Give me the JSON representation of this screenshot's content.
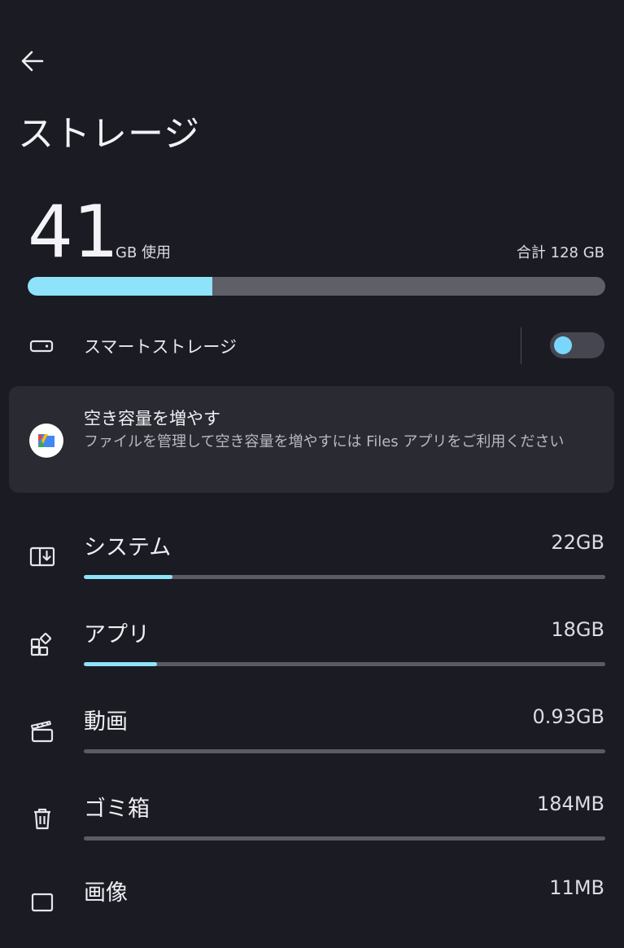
{
  "header": {
    "back_icon": "arrow-left-icon",
    "title": "ストレージ"
  },
  "summary": {
    "used_value": "41",
    "used_unit": "GB 使用",
    "total": "合計 128 GB",
    "used_fraction": 0.32
  },
  "smart_storage": {
    "icon": "storage-toggle-icon",
    "label": "スマートストレージ",
    "enabled": false
  },
  "files_card": {
    "icon": "files-app-icon",
    "title": "空き容量を増やす",
    "description": "ファイルを管理して空き容量を増やすには Files アプリをご利用ください"
  },
  "categories": [
    {
      "icon": "system-icon",
      "name": "システム",
      "size": "22GB",
      "fraction": 0.17
    },
    {
      "icon": "apps-icon",
      "name": "アプリ",
      "size": "18GB",
      "fraction": 0.14
    },
    {
      "icon": "video-icon",
      "name": "動画",
      "size": "0.93GB",
      "fraction": 0.0
    },
    {
      "icon": "trash-icon",
      "name": "ゴミ箱",
      "size": "184MB",
      "fraction": 0.0
    },
    {
      "icon": "image-icon",
      "name": "画像",
      "size": "11MB",
      "fraction": 0.0
    }
  ],
  "colors": {
    "background": "#1b1b23",
    "accent": "#8ee3fb",
    "track": "#5b5b63",
    "card": "#2a2a32"
  }
}
